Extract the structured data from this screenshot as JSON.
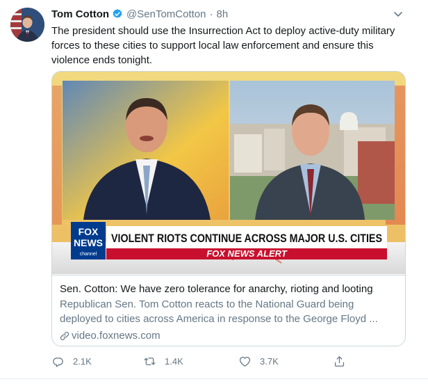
{
  "tweet": {
    "author_name": "Tom Cotton",
    "handle": "@SenTomCotton",
    "separator": "·",
    "time": "8h",
    "text": "The president should use the Insurrection Act to deploy active-duty military forces to these cities to support local law enforcement and ensure this violence ends tonight.",
    "icons": {
      "verified": "verified-badge-icon",
      "menu": "chevron-down-icon"
    }
  },
  "card": {
    "media": {
      "logo_top": "FOX",
      "logo_bottom": "NEWS",
      "logo_sub": "channel",
      "headline": "VIOLENT RIOTS CONTINUE ACROSS MAJOR U.S. CITIES",
      "alert": "FOX NEWS ALERT"
    },
    "title": "Sen. Cotton: We have zero tolerance for anarchy, rioting and looting",
    "description": "Republican Sen. Tom Cotton reacts to the National Guard being deployed to cities across America in response to the George Floyd ...",
    "domain": "video.foxnews.com"
  },
  "actions": {
    "reply_count": "2.1K",
    "retweet_count": "1.4K",
    "like_count": "3.7K"
  },
  "colors": {
    "text": "#14171a",
    "secondary": "#657786",
    "border": "#ccd6dd",
    "verified": "#1da1f2",
    "fox_red": "#c8102e",
    "fox_blue": "#003b8e"
  }
}
